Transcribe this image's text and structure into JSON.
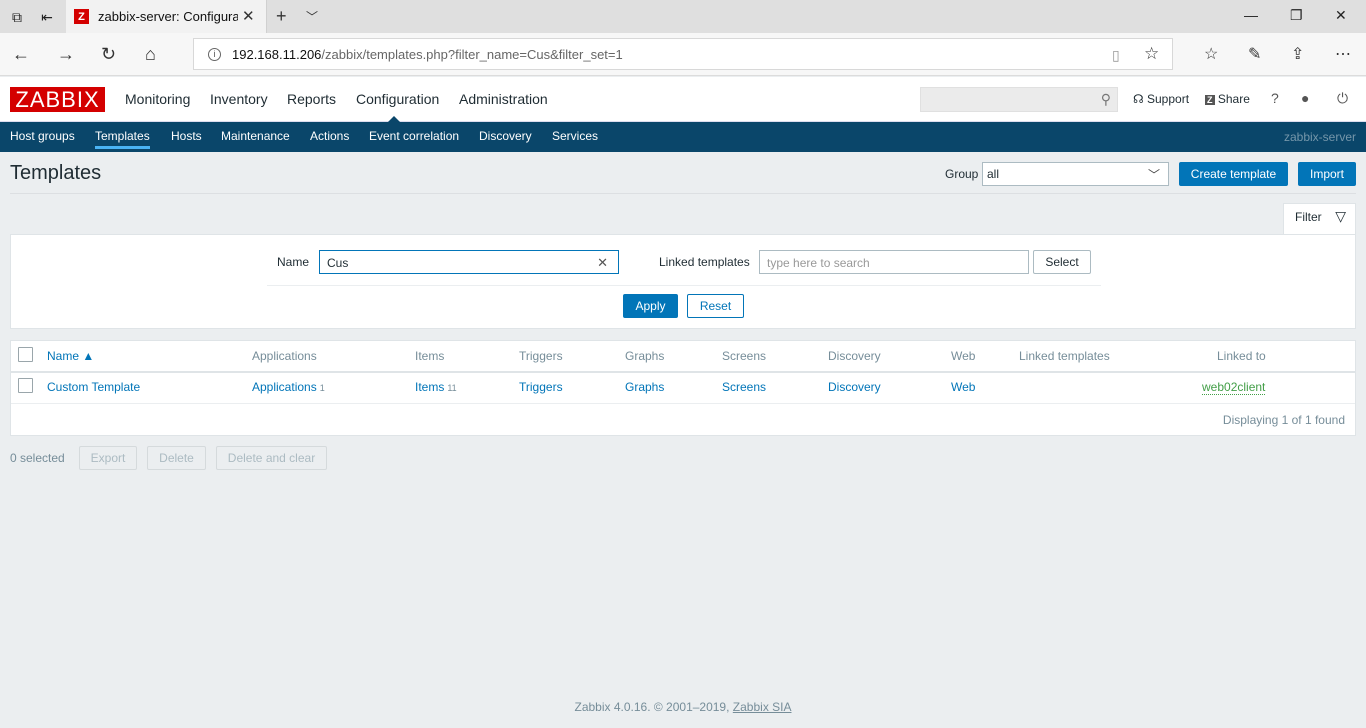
{
  "browser": {
    "tab_title": "zabbix-server: Configura",
    "tab_favicon": "Z",
    "url_host": "192.168.11.206",
    "url_path": "/zabbix/templates.php?filter_name=Cus&filter_set=1"
  },
  "zabbix": {
    "logo": "ZABBIX",
    "top_menu": [
      "Monitoring",
      "Inventory",
      "Reports",
      "Configuration",
      "Administration"
    ],
    "active_top": "Configuration",
    "search_placeholder": "",
    "support_label": "Support",
    "share_label": "Share",
    "help_label": "?",
    "sub_menu": [
      "Host groups",
      "Templates",
      "Hosts",
      "Maintenance",
      "Actions",
      "Event correlation",
      "Discovery",
      "Services"
    ],
    "active_sub": "Templates",
    "server_name": "zabbix-server"
  },
  "page": {
    "title": "Templates",
    "group_label": "Group",
    "group_value": "all",
    "create_button": "Create template",
    "import_button": "Import"
  },
  "filter": {
    "tab_label": "Filter",
    "name_label": "Name",
    "name_value": "Cus",
    "linked_label": "Linked templates",
    "linked_placeholder": "type here to search",
    "select_button": "Select",
    "apply_button": "Apply",
    "reset_button": "Reset"
  },
  "table": {
    "headers": [
      "Name ▲",
      "Applications",
      "Items",
      "Triggers",
      "Graphs",
      "Screens",
      "Discovery",
      "Web",
      "Linked templates",
      "Linked to"
    ],
    "rows": [
      {
        "name": "Custom Template",
        "applications": "Applications",
        "applications_count": "1",
        "items": "Items",
        "items_count": "11",
        "triggers": "Triggers",
        "graphs": "Graphs",
        "screens": "Screens",
        "discovery": "Discovery",
        "web": "Web",
        "linked_templates": "",
        "linked_to": "web02client"
      }
    ],
    "displaying": "Displaying 1 of 1 found"
  },
  "actions": {
    "selected": "0 selected",
    "export": "Export",
    "delete": "Delete",
    "delete_clear": "Delete and clear"
  },
  "footer": {
    "text": "Zabbix 4.0.16. © 2001–2019,",
    "link": "Zabbix SIA"
  },
  "colors": {
    "brand_red": "#d40000",
    "nav_blue": "#0a466a",
    "link_blue": "#0275b8",
    "linked_green": "#429e47"
  }
}
